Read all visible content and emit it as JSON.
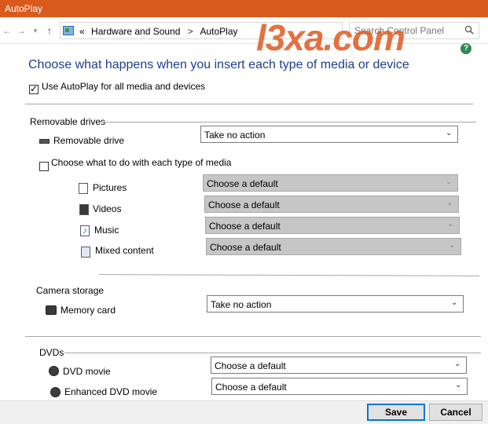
{
  "window": {
    "title": "AutoPlay"
  },
  "address": {
    "prefix": "«",
    "crumbs": [
      "Hardware and Sound",
      "AutoPlay"
    ],
    "separator": ">",
    "search_placeholder": "Search Control Panel"
  },
  "watermark": "l3xa.com",
  "page": {
    "heading": "Choose what happens when you insert each type of media or device",
    "use_autoplay_label": "Use AutoPlay for all media and devices",
    "use_autoplay_checked": true
  },
  "removable": {
    "section_label": "Removable drives",
    "drive_label": "Removable drive",
    "drive_value": "Take no action",
    "per_media_label": "Choose what to do with each type of media",
    "per_media_checked": false,
    "media": [
      {
        "label": "Pictures",
        "value": "Choose a default",
        "icon": "pictures-icon"
      },
      {
        "label": "Videos",
        "value": "Choose a default",
        "icon": "videos-icon"
      },
      {
        "label": "Music",
        "value": "Choose a default",
        "icon": "music-icon"
      },
      {
        "label": "Mixed content",
        "value": "Choose a default",
        "icon": "mixed-content-icon"
      }
    ]
  },
  "camera": {
    "section_label": "Camera storage",
    "card_label": "Memory card",
    "card_value": "Take no action"
  },
  "dvds": {
    "section_label": "DVDs",
    "movie_label": "DVD movie",
    "movie_value": "Choose a default",
    "enhanced_label": "Enhanced DVD movie",
    "enhanced_value": "Choose a default"
  },
  "buttons": {
    "save": "Save",
    "cancel": "Cancel"
  },
  "colors": {
    "titlebar": "#d85a1d",
    "heading": "#1e3e8a",
    "disabled_select": "#c6c6c6"
  }
}
